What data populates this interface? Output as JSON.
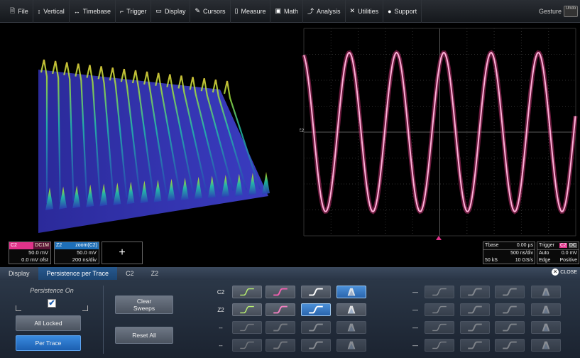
{
  "menu": [
    {
      "label": "File",
      "icon": "file-icon",
      "glyph": "🗎"
    },
    {
      "label": "Vertical",
      "icon": "vertical-icon",
      "glyph": "↕"
    },
    {
      "label": "Timebase",
      "icon": "timebase-icon",
      "glyph": "↔"
    },
    {
      "label": "Trigger",
      "icon": "trigger-icon",
      "glyph": "⌐"
    },
    {
      "label": "Display",
      "icon": "display-icon",
      "glyph": "▭"
    },
    {
      "label": "Cursors",
      "icon": "cursor-icon",
      "glyph": "✎"
    },
    {
      "label": "Measure",
      "icon": "measure-icon",
      "glyph": "▯"
    },
    {
      "label": "Math",
      "icon": "math-icon",
      "glyph": "▣"
    },
    {
      "label": "Analysis",
      "icon": "analysis-icon",
      "glyph": "⤴"
    },
    {
      "label": "Utilities",
      "icon": "utilities-icon",
      "glyph": "✕"
    },
    {
      "label": "Support",
      "icon": "support-icon",
      "glyph": "●"
    }
  ],
  "gesture": "Gesture",
  "undo": "Undo",
  "grid": {
    "trace_label": "Z2"
  },
  "descriptors": {
    "c2": {
      "name": "C2",
      "coupling": "DC1M",
      "vdiv": "50.0 mV",
      "offset": "0.0 mV ofst",
      "color": "#e0338a"
    },
    "z2": {
      "name": "Z2",
      "source": "zoom(C2)",
      "vdiv": "50.0 mV",
      "tdiv": "200 ns/div",
      "color": "#1e6fb8"
    },
    "add": "+"
  },
  "timebase": {
    "label": "Tbase",
    "delay": "0.00 µs",
    "tdiv": "500 ns/div",
    "samples": "50 kS",
    "rate": "10 GS/s"
  },
  "trigger": {
    "label": "Trigger",
    "channel": "C2",
    "coupling": "DC",
    "mode": "Auto",
    "level": "0.0 mV",
    "type": "Edge",
    "slope": "Positive"
  },
  "tabs": [
    {
      "label": "Display",
      "active": false
    },
    {
      "label": "Persistence per Trace",
      "active": true
    },
    {
      "label": "C2",
      "active": false
    },
    {
      "label": "Z2",
      "active": false
    }
  ],
  "close": "CLOSE",
  "persistence": {
    "label": "Persistence On",
    "checked": true
  },
  "buttons": {
    "all_locked": "All Locked",
    "per_trace": "Per Trace",
    "clear_sweeps": "Clear Sweeps",
    "reset_all": "Reset All"
  },
  "rows": [
    {
      "label": "C2",
      "selected": 3,
      "active": true
    },
    {
      "label": "Z2",
      "selected": 2,
      "active": true
    },
    {
      "label": "--",
      "selected": -1,
      "active": false
    },
    {
      "label": "--",
      "selected": -1,
      "active": false
    }
  ],
  "colors": {
    "c2": "#f050a0",
    "z2": "#3aa0ff",
    "grid": "#3a3a3a",
    "accent": "#1c5fb0"
  }
}
